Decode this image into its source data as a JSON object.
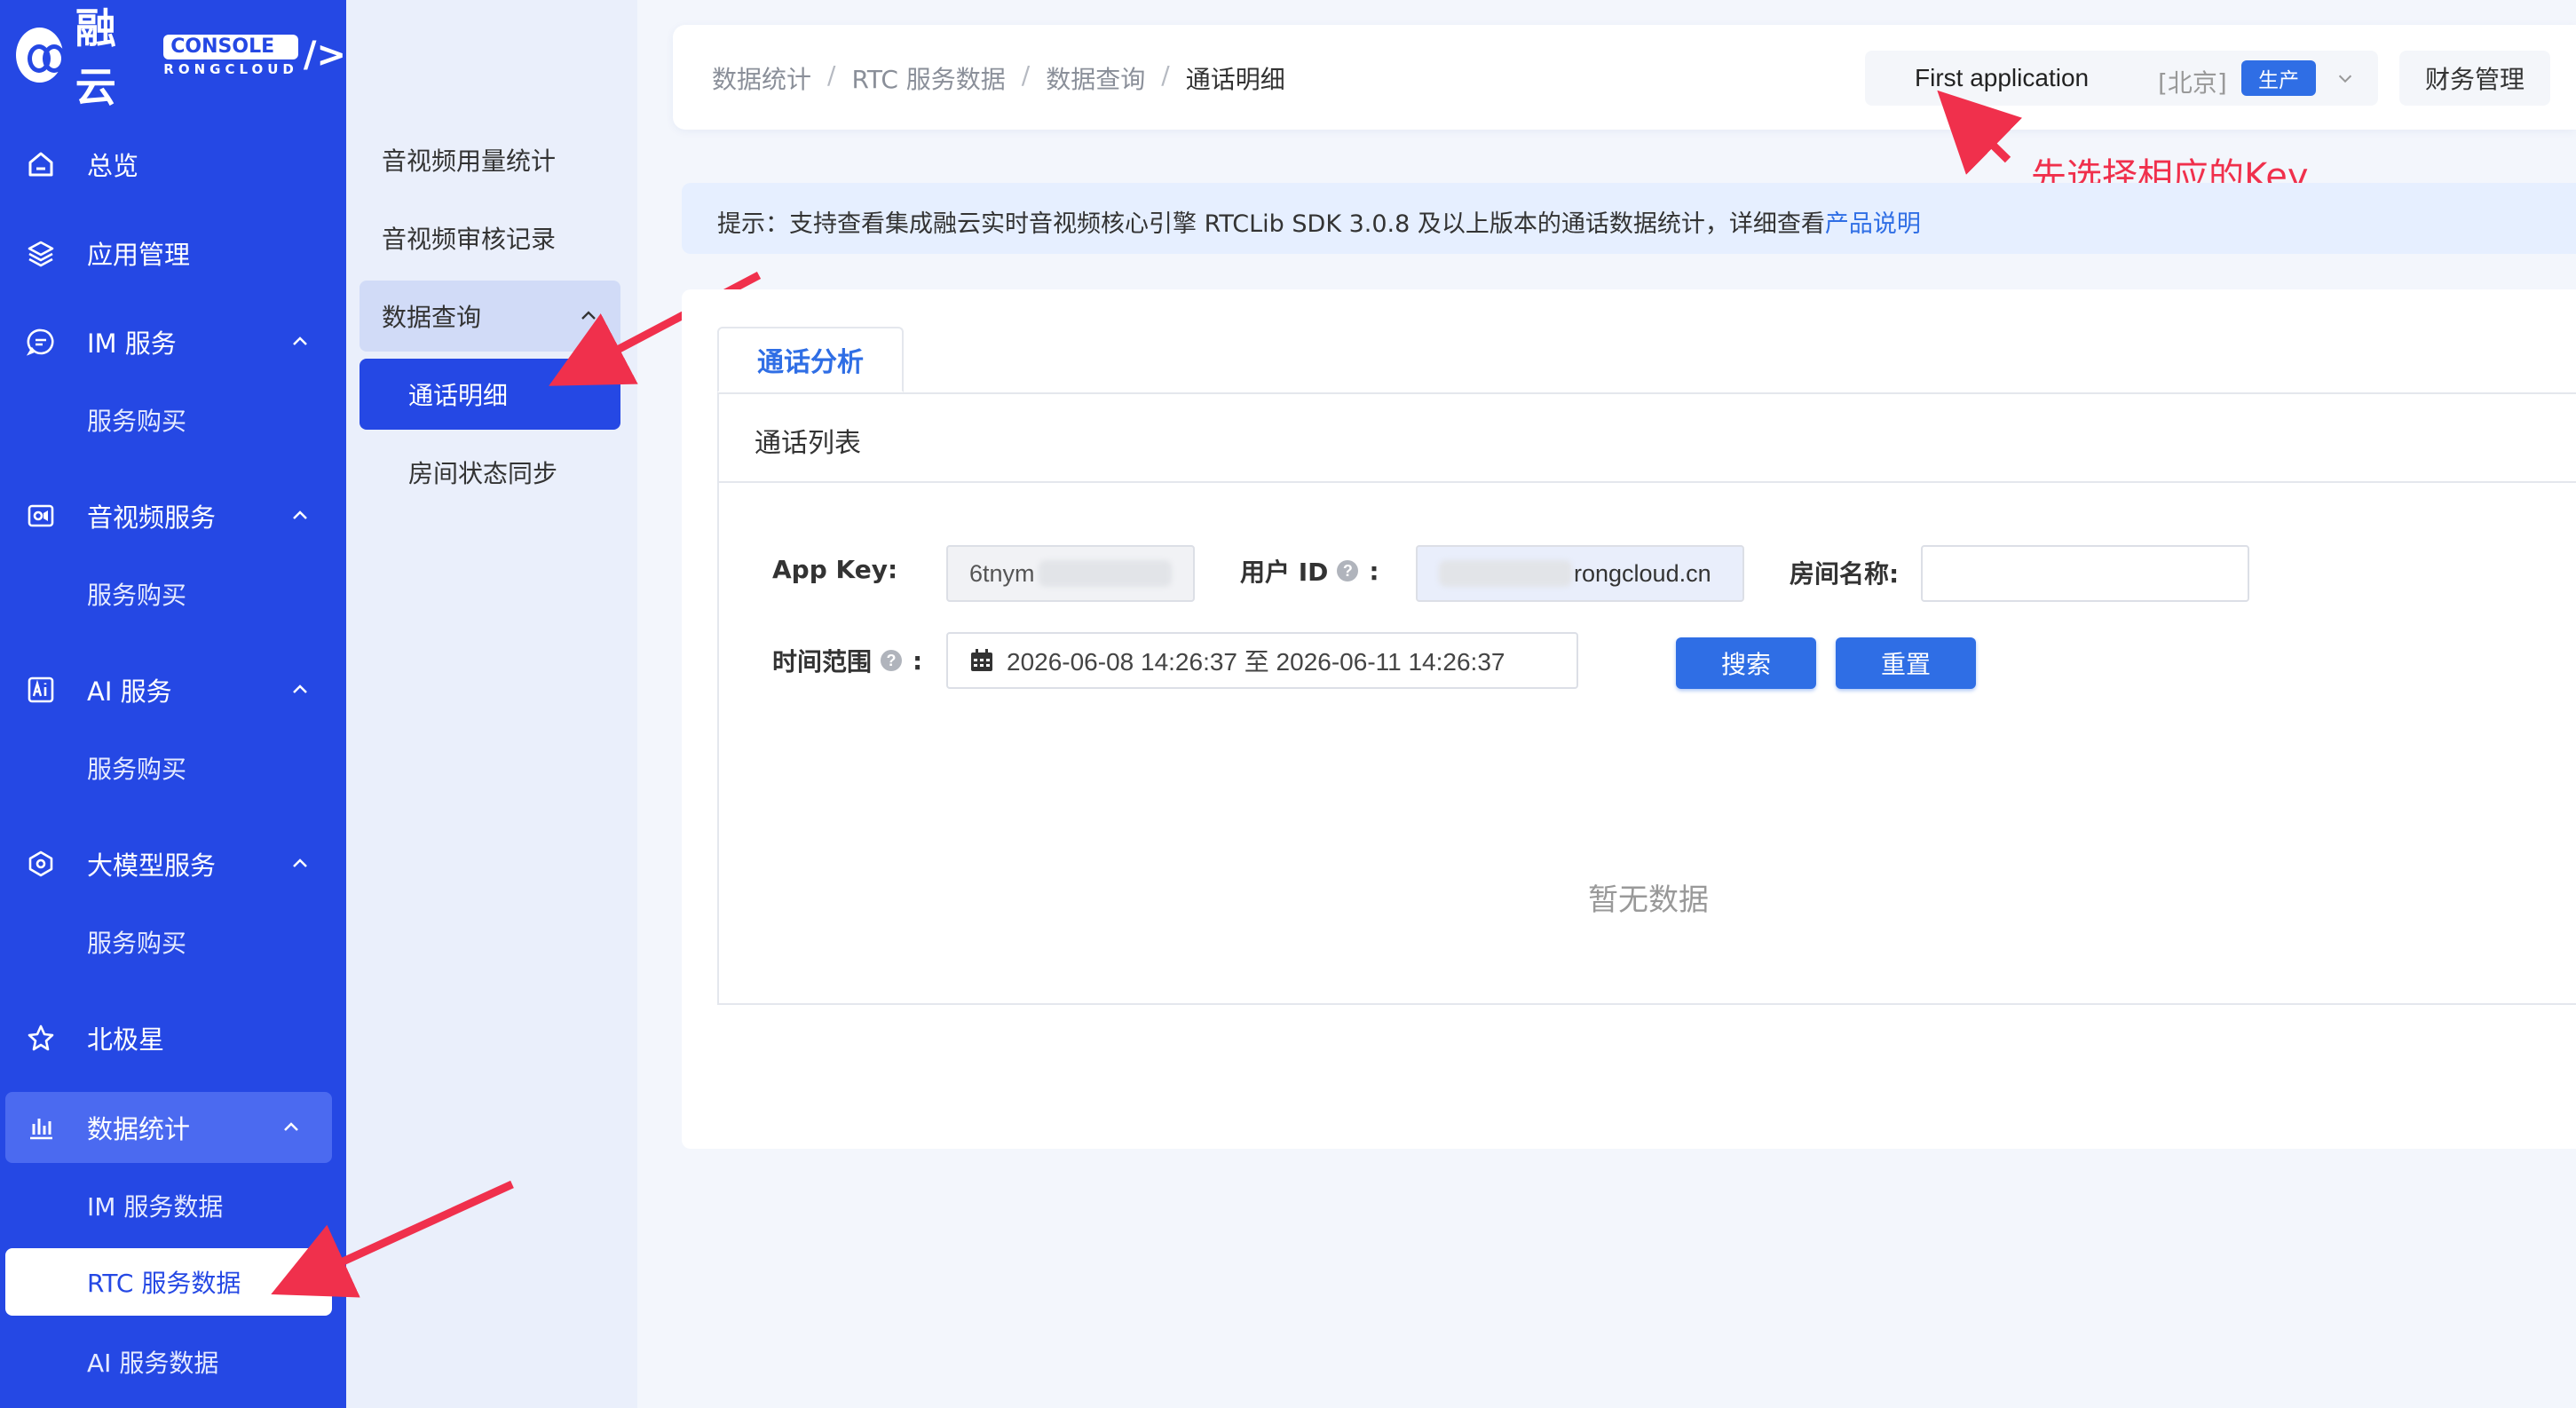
{
  "brand": {
    "name": "融云",
    "console_badge": "CONSOLE",
    "subtitle": "RONGCLOUD",
    "slash": "/>"
  },
  "sidebar": {
    "items": [
      {
        "label": "总览",
        "icon": "home-icon"
      },
      {
        "label": "应用管理",
        "icon": "layers-icon"
      },
      {
        "label": "IM 服务",
        "icon": "chat-icon",
        "sub": "服务购买"
      },
      {
        "label": "音视频服务",
        "icon": "video-icon",
        "sub": "服务购买"
      },
      {
        "label": "AI 服务",
        "icon": "ai-icon",
        "sub": "服务购买"
      },
      {
        "label": "大模型服务",
        "icon": "model-icon",
        "sub": "服务购买"
      },
      {
        "label": "北极星",
        "icon": "star-icon"
      },
      {
        "label": "数据统计",
        "icon": "bar-chart-icon"
      }
    ],
    "stats_sub": [
      "IM 服务数据",
      "RTC 服务数据",
      "AI 服务数据"
    ]
  },
  "submenu": {
    "items": [
      "音视频用量统计",
      "音视频审核记录"
    ],
    "group": "数据查询",
    "group_children": [
      "通话明细",
      "房间状态同步"
    ]
  },
  "breadcrumb": [
    "数据统计",
    "RTC 服务数据",
    "数据查询",
    "通话明细"
  ],
  "app_selector": {
    "name": "First application",
    "region": "[北京]",
    "env": "生产"
  },
  "finance_label": "财务管理",
  "annotation": "先选择相应的Key",
  "tip": {
    "text": "提示：支持查看集成融云实时音视频核心引擎 RTCLib SDK 3.0.8 及以上版本的通话数据统计，详细查看",
    "link": "产品说明"
  },
  "tabs": [
    "通话分析"
  ],
  "panel_title": "通话列表",
  "form": {
    "app_key_label": "App Key:",
    "app_key_value": "6tnym",
    "user_id_label": "用户 ID",
    "user_id_value": "rongcloud.cn",
    "room_label": "房间名称:",
    "room_value": "",
    "time_label": "时间范围",
    "time_value": "2026-06-08 14:26:37 至 2026-06-11 14:26:37",
    "search": "搜索",
    "reset": "重置",
    "colon": ":"
  },
  "empty": "暂无数据",
  "colors": {
    "sidebar": "#2548e4",
    "primary": "#2f6ee5",
    "annotation": "#f0304c"
  }
}
